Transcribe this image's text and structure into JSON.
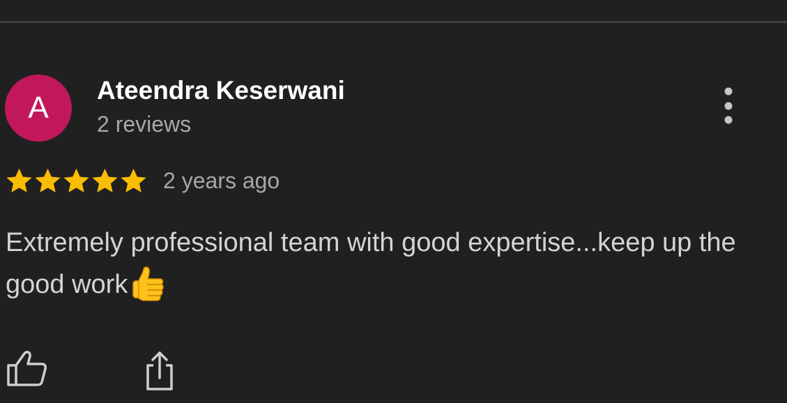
{
  "review": {
    "avatar_initial": "A",
    "avatar_color": "#c2185b",
    "reviewer_name": "Ateendra Keserwani",
    "review_count": "2 reviews",
    "rating": 5,
    "max_rating": 5,
    "date": "2 years ago",
    "text": "Extremely professional team with good expertise...keep up the good work",
    "emoji": "thumbs-up-emoji"
  },
  "actions": {
    "more_icon": "more-vert-icon",
    "like_icon": "thumbs-up-outline-icon",
    "share_icon": "share-icon"
  },
  "colors": {
    "background": "#202020",
    "star": "#fbbc04",
    "name": "#ffffff",
    "secondary_text": "#a8a8a8",
    "body_text": "#d4d4d4"
  }
}
